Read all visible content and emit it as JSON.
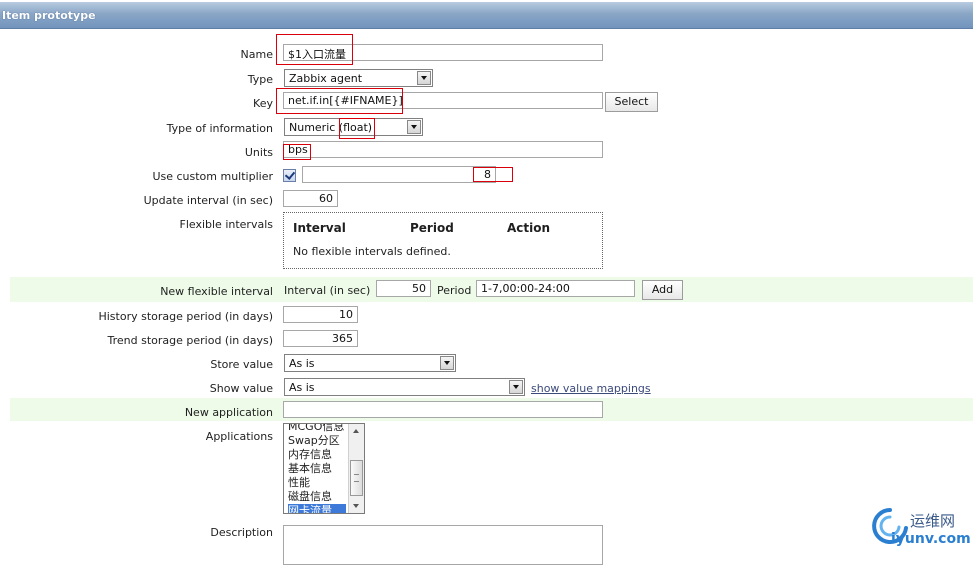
{
  "header": {
    "title": "Item prototype"
  },
  "form": {
    "name": {
      "label": "Name",
      "value": "$1入口流量"
    },
    "type": {
      "label": "Type",
      "value": "Zabbix agent"
    },
    "key": {
      "label": "Key",
      "value": "net.if.in[{#IFNAME}]",
      "select_label": "Select"
    },
    "type_of_information": {
      "label": "Type of information",
      "value": "Numeric (float)"
    },
    "units": {
      "label": "Units",
      "value": "bps"
    },
    "custom_multiplier": {
      "label": "Use custom multiplier",
      "checked": true,
      "value": "8"
    },
    "update_interval": {
      "label": "Update interval (in sec)",
      "value": "60"
    },
    "flexible_intervals": {
      "label": "Flexible intervals",
      "columns": [
        "Interval",
        "Period",
        "Action"
      ],
      "empty_text": "No flexible intervals defined."
    },
    "new_flexible_interval": {
      "label": "New flexible interval",
      "interval_label": "Interval (in sec)",
      "interval_value": "50",
      "period_label": "Period",
      "period_value": "1-7,00:00-24:00",
      "add_label": "Add"
    },
    "history_storage": {
      "label": "History storage period (in days)",
      "value": "10"
    },
    "trend_storage": {
      "label": "Trend storage period (in days)",
      "value": "365"
    },
    "store_value": {
      "label": "Store value",
      "value": "As is"
    },
    "show_value": {
      "label": "Show value",
      "value": "As is",
      "link": "show value mappings"
    },
    "new_application": {
      "label": "New application",
      "value": ""
    },
    "applications": {
      "label": "Applications",
      "items": [
        "MCGO信息",
        "Swap分区",
        "内存信息",
        "基本信息",
        "性能",
        "磁盘信息",
        "网卡流量"
      ],
      "selected": "网卡流量"
    },
    "description": {
      "label": "Description",
      "value": ""
    }
  },
  "watermark": {
    "cn": "运维网",
    "url": "iyunv.com"
  },
  "colors": {
    "highlight": "#d9000b",
    "header": "#7f9dc4",
    "green_row": "#eefbe9"
  }
}
